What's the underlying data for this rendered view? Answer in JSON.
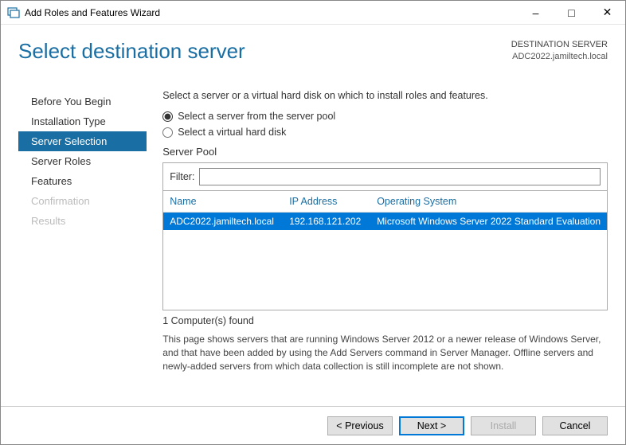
{
  "window": {
    "title": "Add Roles and Features Wizard"
  },
  "header": {
    "page_title": "Select destination server",
    "dest_label": "DESTINATION SERVER",
    "dest_value": "ADC2022.jamiltech.local"
  },
  "sidebar": {
    "items": [
      {
        "label": "Before You Begin",
        "state": "normal"
      },
      {
        "label": "Installation Type",
        "state": "normal"
      },
      {
        "label": "Server Selection",
        "state": "active"
      },
      {
        "label": "Server Roles",
        "state": "normal"
      },
      {
        "label": "Features",
        "state": "normal"
      },
      {
        "label": "Confirmation",
        "state": "disabled"
      },
      {
        "label": "Results",
        "state": "disabled"
      }
    ]
  },
  "main": {
    "instruction": "Select a server or a virtual hard disk on which to install roles and features.",
    "radio1": "Select a server from the server pool",
    "radio2": "Select a virtual hard disk",
    "pool_label": "Server Pool",
    "filter_label": "Filter:",
    "filter_value": "",
    "columns": {
      "name": "Name",
      "ip": "IP Address",
      "os": "Operating System"
    },
    "rows": [
      {
        "name": "ADC2022.jamiltech.local",
        "ip": "192.168.121.202",
        "os": "Microsoft Windows Server 2022 Standard Evaluation"
      }
    ],
    "count_text": "1 Computer(s) found",
    "hint": "This page shows servers that are running Windows Server 2012 or a newer release of Windows Server, and that have been added by using the Add Servers command in Server Manager. Offline servers and newly-added servers from which data collection is still incomplete are not shown."
  },
  "footer": {
    "previous": "< Previous",
    "next": "Next >",
    "install": "Install",
    "cancel": "Cancel"
  }
}
